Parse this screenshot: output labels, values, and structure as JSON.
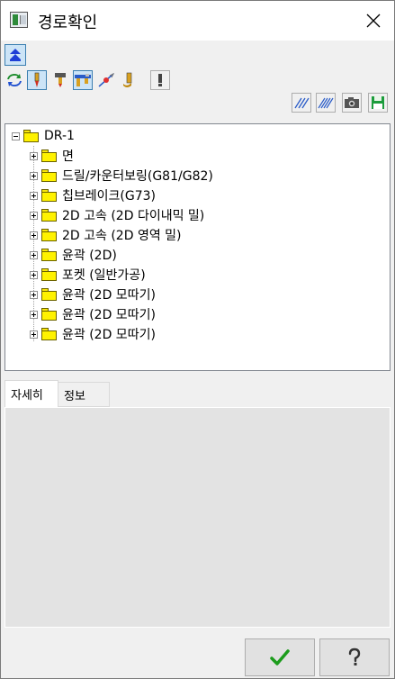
{
  "window": {
    "title": "경로확인"
  },
  "toolbar": {
    "row1": [
      {
        "icon": "collapse-up-icon"
      }
    ],
    "row2": [
      {
        "icon": "refresh-cycle-icon"
      },
      {
        "icon": "tool-pin-icon"
      },
      {
        "icon": "drill-tool-icon"
      },
      {
        "icon": "mill-holder-icon"
      },
      {
        "icon": "path-point-icon"
      },
      {
        "icon": "ball-end-tool-icon"
      },
      {
        "icon": "warning-exclamation-icon"
      }
    ],
    "row3": [
      {
        "icon": "hatch-lines-icon"
      },
      {
        "icon": "hatch-dense-icon"
      },
      {
        "icon": "camera-icon"
      },
      {
        "icon": "save-disk-icon"
      }
    ]
  },
  "tree": {
    "root": "DR-1",
    "children": [
      "면",
      "드릴/카운터보링(G81/G82)",
      "칩브레이크(G73)",
      "2D 고속 (2D 다이내믹 밀)",
      "2D 고속 (2D 영역 밀)",
      "윤곽 (2D)",
      "포켓 (일반가공)",
      "윤곽 (2D 모따기)",
      "윤곽 (2D 모따기)",
      "윤곽 (2D 모따기)"
    ]
  },
  "tabs": {
    "detail": "자세히",
    "info": "정보"
  },
  "buttons": {
    "ok_icon": "check-icon",
    "help_icon": "help-question-icon"
  },
  "colors": {
    "folder": "#fff200",
    "selection": "#cce4f7",
    "ok_check": "#1c9c1c"
  }
}
